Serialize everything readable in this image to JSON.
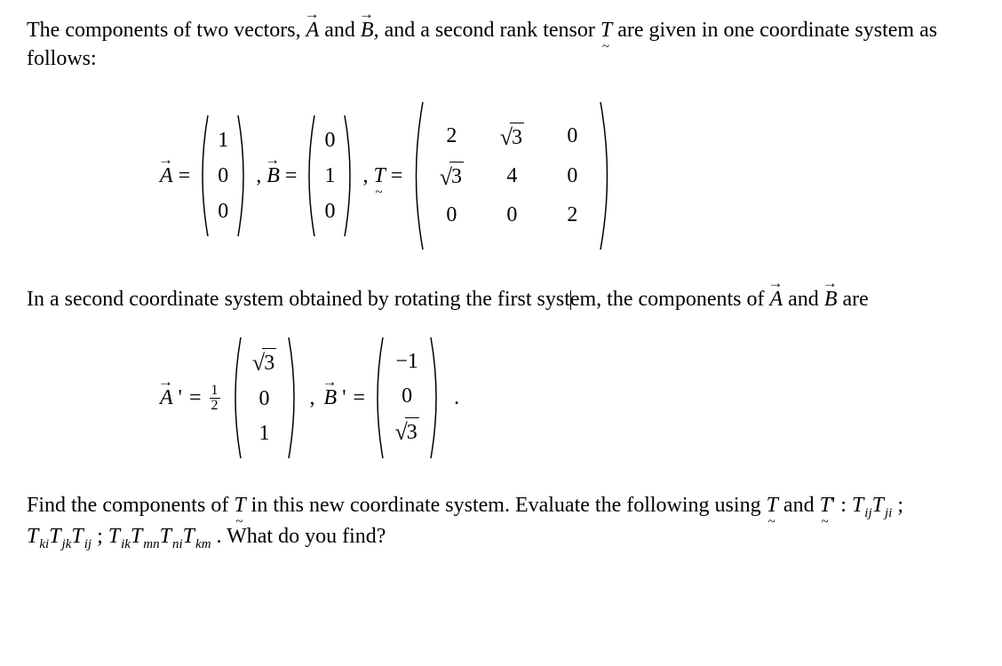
{
  "para1_a": "The components of two vectors, ",
  "para1_b": " and ",
  "para1_c": ", and a second rank tensor ",
  "para1_d": " are given in one coordinate system as follows:",
  "sym_A": "A",
  "sym_B": "B",
  "sym_T": "T",
  "eq1": {
    "eq": " = ",
    "A": [
      "1",
      "0",
      "0"
    ],
    "B": [
      "0",
      "1",
      "0"
    ],
    "T": [
      [
        "2",
        "√3",
        "0"
      ],
      [
        "√3",
        "4",
        "0"
      ],
      [
        "0",
        "0",
        "2"
      ]
    ]
  },
  "comma_sep": ",",
  "para2_a": "In a second coordinate system obtained by rotating the first syst",
  "para2_b": "em, the components of ",
  "para2_c": " and ",
  "para2_d": " are",
  "eq2": {
    "prime": "'",
    "eq": " = ",
    "half_n": "1",
    "half_d": "2",
    "Ap": [
      "√3",
      "0",
      "1"
    ],
    "Bp": [
      "−1",
      "0",
      "√3"
    ],
    "period": " ."
  },
  "para3_a": "Find the components of ",
  "para3_b": " in this new coordinate system. Evaluate the following using ",
  "para3_c": " and ",
  "para3_prime": "'",
  "para3_colon": " : ",
  "inv1": {
    "t1": "T",
    "s1": "ij",
    "t2": "T",
    "s2": "ji"
  },
  "inv2": {
    "t1": "T",
    "s1": "ki",
    "t2": "T",
    "s2": "jk",
    "t3": "T",
    "s3": "ij"
  },
  "inv3": {
    "t1": "T",
    "s1": "ik",
    "t2": "T",
    "s2": "mn",
    "t3": "T",
    "s3": "ni",
    "t4": "T",
    "s4": "km"
  },
  "sep": " ; ",
  "para3_end": " . What do you find?"
}
